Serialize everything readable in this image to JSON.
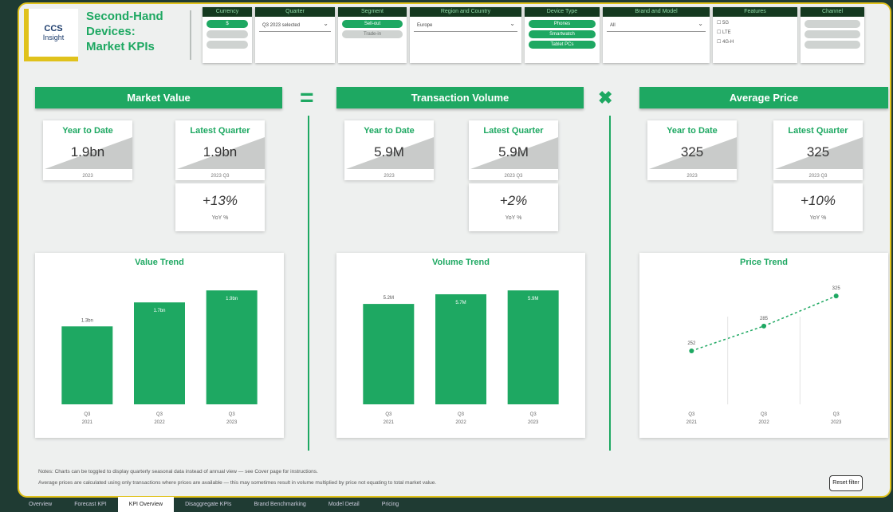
{
  "app": {
    "logo_line1": "CCS",
    "logo_line2": "Insight",
    "title_lines": [
      "Second-Hand",
      "Devices:",
      "Market KPIs"
    ]
  },
  "filters": [
    {
      "label": "Currency",
      "options": [
        {
          "text": "$",
          "selected": true
        },
        {
          "text": "",
          "selected": false
        },
        {
          "text": "",
          "selected": false
        }
      ]
    },
    {
      "label": "Quarter",
      "dropdown": "Q3 2023 selected"
    },
    {
      "label": "Segment",
      "options": [
        {
          "text": "Sell-out",
          "selected": true
        },
        {
          "text": "Trade-in",
          "selected": false
        }
      ]
    },
    {
      "label": "Region and Country",
      "dropdown": "Europe"
    },
    {
      "label": "Device Type",
      "options": [
        {
          "text": "Phones",
          "selected": true
        },
        {
          "text": "Smartwatch",
          "selected": true
        },
        {
          "text": "Tablet PCs",
          "selected": true
        }
      ]
    },
    {
      "label": "Brand and Model",
      "dropdown": "All"
    },
    {
      "label": "Features",
      "checks": [
        "5G",
        "LTE",
        "4G-H"
      ]
    },
    {
      "label": "Channel",
      "options": [
        {
          "text": "",
          "selected": false
        },
        {
          "text": "",
          "selected": false
        },
        {
          "text": "",
          "selected": false
        }
      ]
    }
  ],
  "sections": [
    {
      "header": "Market Value",
      "ytd": {
        "label": "Year to Date",
        "value": "1.9bn",
        "sub": "2023"
      },
      "lq": {
        "label": "Latest Quarter",
        "value": "1.9bn",
        "sub": "2023 Q3"
      },
      "yoy": {
        "value": "+13%",
        "label": "YoY %"
      },
      "chart_title": "Value Trend"
    },
    {
      "header": "Transaction Volume",
      "ytd": {
        "label": "Year to Date",
        "value": "5.9M",
        "sub": "2023"
      },
      "lq": {
        "label": "Latest Quarter",
        "value": "5.9M",
        "sub": "2023 Q3"
      },
      "yoy": {
        "value": "+2%",
        "label": "YoY %"
      },
      "chart_title": "Volume Trend"
    },
    {
      "header": "Average Price",
      "ytd": {
        "label": "Year to Date",
        "value": "325",
        "sub": "2023"
      },
      "lq": {
        "label": "Latest Quarter",
        "value": "325",
        "sub": "2023 Q3"
      },
      "yoy": {
        "value": "+10%",
        "label": "YoY %"
      },
      "chart_title": "Price Trend"
    }
  ],
  "operators": {
    "equals": "=",
    "times": "✖"
  },
  "chart_data": [
    {
      "type": "bar",
      "title": "Value Trend",
      "categories": [
        [
          "Q3",
          "2021"
        ],
        [
          "Q3",
          "2022"
        ],
        [
          "Q3",
          "2023"
        ]
      ],
      "values": [
        1.3,
        1.7,
        1.9
      ],
      "labels": [
        "1.3bn",
        "1.7bn",
        "1.9bn"
      ],
      "color": "#1ea862"
    },
    {
      "type": "bar",
      "title": "Volume Trend",
      "categories": [
        [
          "Q3",
          "2021"
        ],
        [
          "Q3",
          "2022"
        ],
        [
          "Q3",
          "2023"
        ]
      ],
      "values": [
        5.2,
        5.7,
        5.9
      ],
      "labels": [
        "5.2M",
        "5.7M",
        "5.9M"
      ],
      "color": "#1ea862"
    },
    {
      "type": "line",
      "title": "Price Trend",
      "categories": [
        [
          "Q3",
          "2021"
        ],
        [
          "Q3",
          "2022"
        ],
        [
          "Q3",
          "2023"
        ]
      ],
      "values": [
        252,
        285,
        325
      ],
      "labels": [
        "252",
        "285",
        "325"
      ],
      "color": "#1ea862"
    }
  ],
  "notes": [
    "Notes: Charts can be toggled to display quarterly seasonal data instead of annual view — see Cover page for instructions.",
    "Average prices are calculated using only transactions where prices are available — this may sometimes result in volume multiplied by price not equating to total market value."
  ],
  "reset_label": "Reset filter",
  "tabs": [
    {
      "label": "Overview",
      "active": false
    },
    {
      "label": "Forecast KPI",
      "active": false
    },
    {
      "label": "KPI Overview",
      "active": true
    },
    {
      "label": "Disaggregate KPIs",
      "active": false
    },
    {
      "label": "Brand Benchmarking",
      "active": false
    },
    {
      "label": "Model Detail",
      "active": false
    },
    {
      "label": "Pricing",
      "active": false
    }
  ]
}
